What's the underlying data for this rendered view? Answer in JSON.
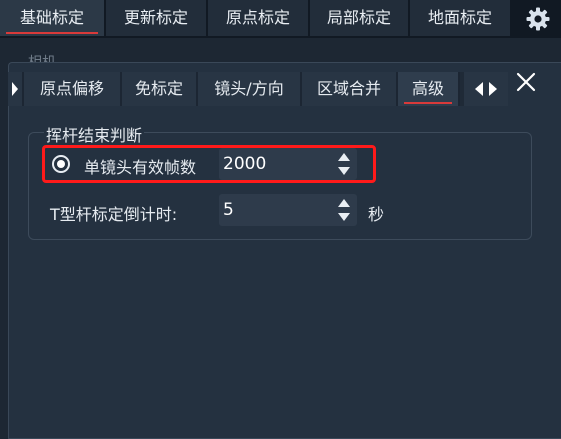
{
  "top_tabs": [
    {
      "label": "基础标定",
      "active": true
    },
    {
      "label": "更新标定",
      "active": false
    },
    {
      "label": "原点标定",
      "active": false
    },
    {
      "label": "局部标定",
      "active": false
    },
    {
      "label": "地面标定",
      "active": false
    }
  ],
  "settings_icon": "gear-icon",
  "background_label": "相机",
  "sub_tabs": [
    {
      "label": "原点偏移",
      "active": false
    },
    {
      "label": "免标定",
      "active": false
    },
    {
      "label": "镜头/方向",
      "active": false
    },
    {
      "label": "区域合并",
      "active": false
    },
    {
      "label": "高级",
      "active": true
    }
  ],
  "close_icon": "close-icon",
  "group": {
    "title": "挥杆结束判断",
    "single_lens": {
      "label": "单镜头有效帧数",
      "value": "2000",
      "selected": true
    },
    "t_rod": {
      "label": "T型杆标定倒计时:",
      "value": "5",
      "unit": "秒"
    }
  },
  "colors": {
    "accent_underline": "#d93a3a",
    "highlight_box": "#ff1a1a"
  }
}
